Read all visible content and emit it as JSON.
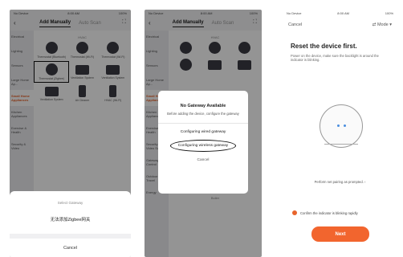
{
  "status_bar": {
    "carrier": "No Device",
    "time": "8:00 AM",
    "battery": "100%"
  },
  "screen1": {
    "tab_active": "Add Manually",
    "tab_inactive": "Auto Scan",
    "sidebar": [
      "Electrical",
      "Lighting",
      "Sensors",
      "Large Home Ap...",
      "Small Home Appliances",
      "Kitchen Appliances",
      "Exercise & Health",
      "Security & Video"
    ],
    "section": "HVAC",
    "devices": [
      "Thermostat (Bluetooth)",
      "Thermostat (Wi-Fi)",
      "Thermostat (Wi-Fi)",
      "Thermostat (Zigbee)",
      "Ventilation System",
      "Ventilation System",
      "Ventilation System",
      "Air Cleaner",
      "HVAC (Wi-Fi)"
    ],
    "sheet_title": "Select Gateway",
    "sheet_option": "无法添加Zigbee网关",
    "sheet_cancel": "Cancel"
  },
  "screen2": {
    "tab_active": "Add Manually",
    "tab_inactive": "Auto Scan",
    "sidebar": [
      "Electrical",
      "Lighting",
      "Sensors",
      "Large Home Ap...",
      "Small Home Appliances",
      "Kitchen Appliances",
      "Exercise & Health",
      "Security & Video Surv...",
      "Gateway Control",
      "Outdoor Travel",
      "Energy"
    ],
    "section": "HVAC",
    "section2": "Boiler",
    "dialog_title": "No Gateway Available",
    "dialog_message": "Before adding the device, configure the gateway",
    "option_wired": "Configuring wired gateway",
    "option_wireless": "Configuring wireless gateway",
    "cancel": "Cancel"
  },
  "screen3": {
    "cancel": "Cancel",
    "mode": "Mode",
    "title": "Reset the device first.",
    "description": "Power on the device, make sure the backlight is around the indicator is blinking.",
    "link": "Perform net pairing as prompted.",
    "confirm": "Confirm the indicator is blinking rapidly",
    "next": "Next",
    "accent": "#f2652e"
  }
}
